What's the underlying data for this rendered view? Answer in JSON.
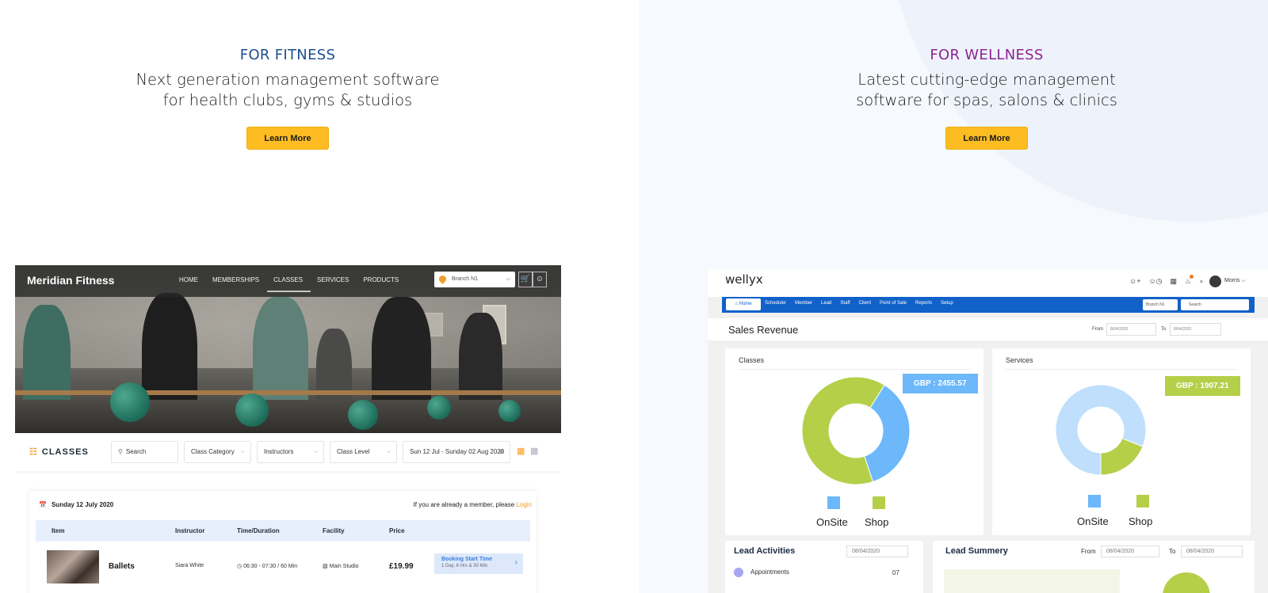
{
  "fitness": {
    "eyebrow": "FOR FITNESS",
    "tagline_line1": "Next generation management software",
    "tagline_line2": "for health clubs, gyms & studios",
    "button": "Learn More"
  },
  "wellness": {
    "eyebrow": "FOR WELLNESS",
    "tagline_line1": "Latest cutting-edge management",
    "tagline_line2": "software for spas, salons & clinics",
    "button": "Learn More"
  },
  "fitness_app": {
    "brand": "Meridian Fitness",
    "nav": [
      "HOME",
      "MEMBERSHIPS",
      "CLASSES",
      "SERVICES",
      "PRODUCTS"
    ],
    "active_nav": "CLASSES",
    "branch": "Branch N1",
    "section_title": "CLASSES",
    "filters": {
      "search_placeholder": "Search",
      "category": "Class Category",
      "instructors": "Instructors",
      "level": "Class Level",
      "date_range": "Sun 12  Jul - Sunday 02 Aug 2020"
    },
    "list_date": "Sunday 12 July 2020",
    "member_prompt": "If you are already a member, please",
    "login_link": "Login",
    "columns": [
      "Item",
      "Instructor",
      "Time/Duration",
      "Facility",
      "Price"
    ],
    "rows": [
      {
        "item": "Ballets",
        "instructor": "Siara White",
        "time": "06:30 - 07:30 / 60 Min",
        "facility": "Main Studio",
        "price": "£19.99",
        "booking_title": "Booking Start Time",
        "booking_sub": "1 Day, 6 Hrs & 30 Min"
      }
    ]
  },
  "wellyx_app": {
    "logo": "wellyx",
    "user": "Morris",
    "menu": [
      "Home",
      "Scheduler",
      "Member",
      "Lead",
      "Staff",
      "Client",
      "Point of Sale",
      "Reports",
      "Setup"
    ],
    "branch": "Branch N1",
    "search_placeholder": "Search",
    "page_title": "Sales Revenue",
    "from_label": "From",
    "to_label": "To",
    "from_date": "8/04/2020",
    "to_date": "8/04/2020",
    "lead_activities_title": "Lead Activities",
    "lead_activities_date": "08/04/2020",
    "lead_activities_row_label": "Appointments",
    "lead_activities_row_value": "07",
    "lead_summary_title": "Lead Summery",
    "lead_summary_from": "08/04/2020",
    "lead_summary_to": "08/04/2020",
    "colors": {
      "onsite": "#6cb8fb",
      "shop": "#b5cf49",
      "onsite_light": "#bfdffc"
    }
  },
  "chart_data": [
    {
      "type": "pie",
      "title": "Classes",
      "annotation": "GBP : 2455.57",
      "categories": [
        "OnSite",
        "Shop"
      ],
      "values": [
        36,
        64
      ]
    },
    {
      "type": "pie",
      "title": "Services",
      "annotation": "GBP : 1907.21",
      "categories": [
        "OnSite",
        "Shop"
      ],
      "values": [
        81,
        19
      ]
    }
  ]
}
